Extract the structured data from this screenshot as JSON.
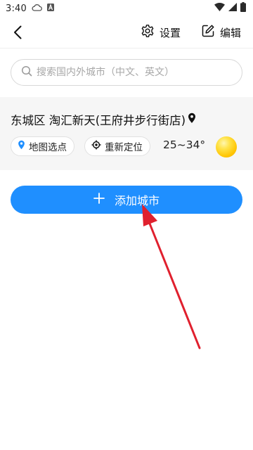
{
  "status_bar": {
    "time": "3:40"
  },
  "header": {
    "settings_label": "设置",
    "edit_label": "编辑"
  },
  "search": {
    "placeholder": "搜索国内外城市（中文、英文）"
  },
  "location": {
    "title": "东城区 淘汇新天(王府井步行街店)",
    "map_pick_label": "地图选点",
    "relocate_label": "重新定位",
    "temperature_range": "25~34°",
    "weather_icon": "sun-icon"
  },
  "add_city": {
    "label": "添加城市"
  },
  "colors": {
    "accent": "#1f8fff",
    "annotation": "#e0202e"
  }
}
